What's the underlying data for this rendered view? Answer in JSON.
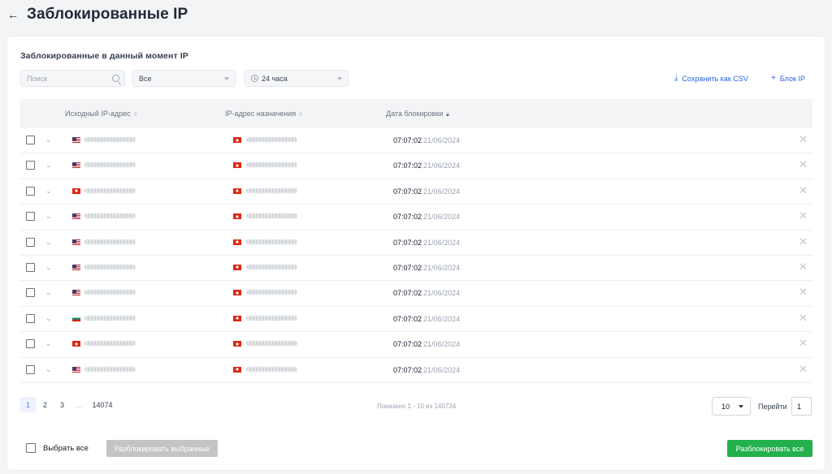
{
  "header": {
    "back_icon": "arrow-left-icon",
    "title": "Заблокированные IP"
  },
  "card": {
    "subtitle": "Заблокированные в данный момент IP",
    "filters": {
      "search_placeholder": "Поиск",
      "type_value": "Все",
      "period_value": "24 часа"
    },
    "actions": {
      "save_csv": "Сохранить как CSV",
      "block_ip": "Блок IP"
    }
  },
  "table": {
    "columns": {
      "source_ip": "Исходный IP-адрес",
      "destination_ip": "IP-адрес назначения",
      "block_date": "Дата блокировки"
    },
    "rows": [
      {
        "src_flag": "us",
        "dst_flag": "hk",
        "time": "07:07:02",
        "date": "21/06/2024"
      },
      {
        "src_flag": "us",
        "dst_flag": "hk",
        "time": "07:07:02",
        "date": "21/06/2024"
      },
      {
        "src_flag": "hk",
        "dst_flag": "hk",
        "time": "07:07:02",
        "date": "21/06/2024"
      },
      {
        "src_flag": "us",
        "dst_flag": "hk",
        "time": "07:07:02",
        "date": "21/06/2024"
      },
      {
        "src_flag": "us",
        "dst_flag": "hk",
        "time": "07:07:02",
        "date": "21/06/2024"
      },
      {
        "src_flag": "us",
        "dst_flag": "hk",
        "time": "07:07:02",
        "date": "21/06/2024"
      },
      {
        "src_flag": "us",
        "dst_flag": "hk",
        "time": "07:07:02",
        "date": "21/06/2024"
      },
      {
        "src_flag": "bg",
        "dst_flag": "hk",
        "time": "07:07:02",
        "date": "21/06/2024"
      },
      {
        "src_flag": "hk",
        "dst_flag": "hk",
        "time": "07:07:02",
        "date": "21/06/2024"
      },
      {
        "src_flag": "us",
        "dst_flag": "hk",
        "time": "07:07:02",
        "date": "21/06/2024"
      }
    ]
  },
  "pagination": {
    "pages": [
      "1",
      "2",
      "3",
      "…",
      "14074"
    ],
    "current": "1",
    "shown_text": "Показано 1 - 10 из 140734",
    "per_page": "10",
    "goto_label": "Перейти",
    "goto_value": "1"
  },
  "footer": {
    "select_all": "Выбрать все",
    "unblock_selected": "Разблокировать выбранные",
    "unblock_all": "Разблокировать все"
  },
  "colors": {
    "accent_link": "#2563eb",
    "unblock_all_bg": "#22b14c",
    "unblock_selected_bg": "#c4c4c4"
  }
}
